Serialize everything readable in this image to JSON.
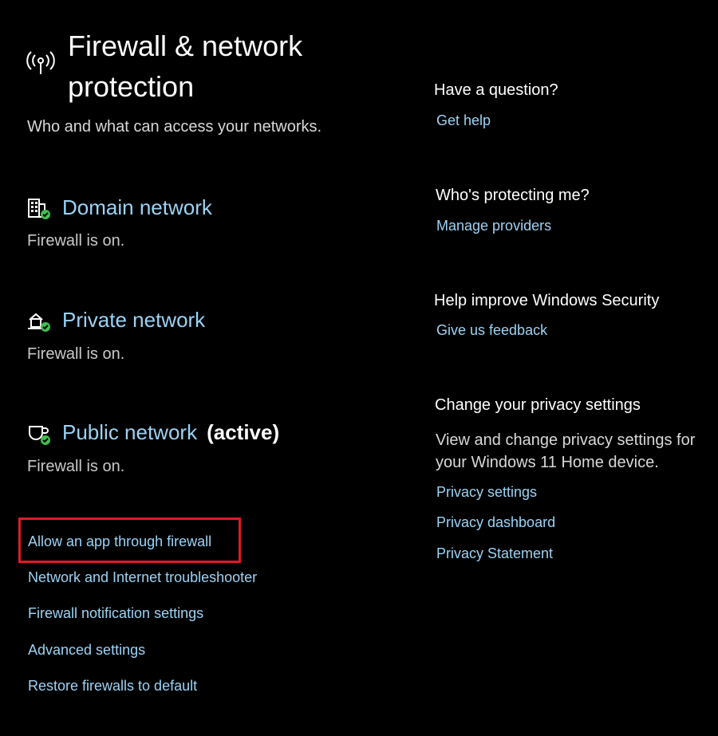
{
  "page": {
    "title": "Firewall & network protection",
    "subtitle": "Who and what can access your networks.",
    "title_icon": "wireless-antenna-icon"
  },
  "networks": [
    {
      "name": "Domain network",
      "status": "Firewall is on.",
      "badge": "",
      "icon": "domain-building-icon"
    },
    {
      "name": "Private network",
      "status": "Firewall is on.",
      "badge": "",
      "icon": "private-home-network-icon"
    },
    {
      "name": "Public network",
      "status": "Firewall is on.",
      "badge": "(active)",
      "icon": "public-cafe-network-icon"
    }
  ],
  "links": {
    "allow_app": "Allow an app through firewall",
    "troubleshooter": "Network and Internet troubleshooter",
    "notifications": "Firewall notification settings",
    "advanced": "Advanced settings",
    "restore": "Restore firewalls to default"
  },
  "sidebar": {
    "question": {
      "heading": "Have a question?",
      "link": "Get help"
    },
    "protecting": {
      "heading": "Who's protecting me?",
      "link": "Manage providers"
    },
    "improve": {
      "heading": "Help improve Windows Security",
      "link": "Give us feedback"
    },
    "privacy": {
      "heading": "Change your privacy settings",
      "description": "View and change privacy settings for your Windows 11 Home device.",
      "links": [
        "Privacy settings",
        "Privacy dashboard",
        "Privacy Statement"
      ]
    }
  },
  "colors": {
    "background": "#000000",
    "link": "#9bd3f5",
    "highlight": "#e01b24",
    "check": "#3fbf4f"
  }
}
